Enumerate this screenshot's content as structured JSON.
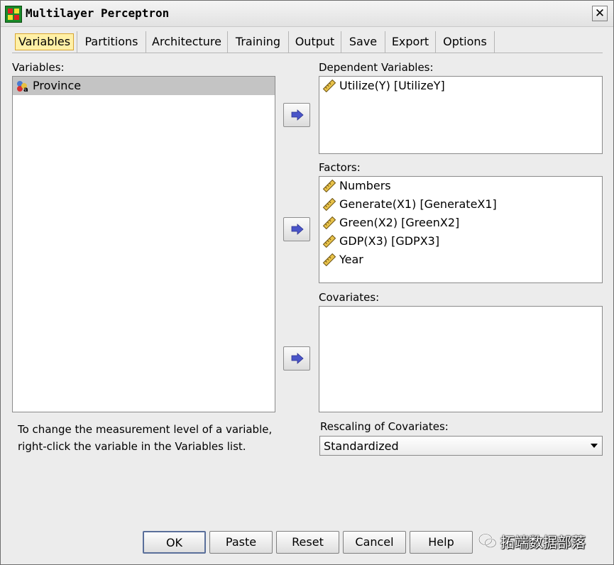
{
  "window": {
    "title": "Multilayer Perceptron"
  },
  "tabs": [
    {
      "label": "Variables",
      "active": true
    },
    {
      "label": "Partitions"
    },
    {
      "label": "Architecture"
    },
    {
      "label": "Training"
    },
    {
      "label": "Output"
    },
    {
      "label": "Save"
    },
    {
      "label": "Export"
    },
    {
      "label": "Options"
    }
  ],
  "variables": {
    "label": "Variables:",
    "items": [
      {
        "name": "Province",
        "icon": "nominal-string-variable-icon",
        "selected": true
      }
    ]
  },
  "dependent": {
    "label": "Dependent Variables:",
    "items": [
      {
        "name": "Utilize(Y) [UtilizeY]",
        "icon": "scale-ruler-icon"
      }
    ]
  },
  "factors": {
    "label": "Factors:",
    "items": [
      {
        "name": "Numbers",
        "icon": "scale-ruler-icon"
      },
      {
        "name": "Generate(X1) [GenerateX1]",
        "icon": "scale-ruler-icon"
      },
      {
        "name": "Green(X2) [GreenX2]",
        "icon": "scale-ruler-icon"
      },
      {
        "name": "GDP(X3) [GDPX3]",
        "icon": "scale-ruler-icon"
      },
      {
        "name": "Year",
        "icon": "scale-ruler-icon"
      }
    ]
  },
  "covariates": {
    "label": "Covariates:",
    "items": []
  },
  "note": {
    "line1": "To change the measurement level of a variable,",
    "line2": "right-click the variable in the Variables list."
  },
  "rescaling": {
    "label": "Rescaling of Covariates:",
    "value": "Standardized"
  },
  "buttons": {
    "ok": "OK",
    "paste": "Paste",
    "reset": "Reset",
    "cancel": "Cancel",
    "help": "Help"
  },
  "watermark": {
    "text": "拓端数据部落",
    "icon": "wechat-icon"
  },
  "colors": {
    "window_bg": "#ececec",
    "active_tab_bg": "#fff0a6",
    "arrow": "#4a55c8"
  }
}
